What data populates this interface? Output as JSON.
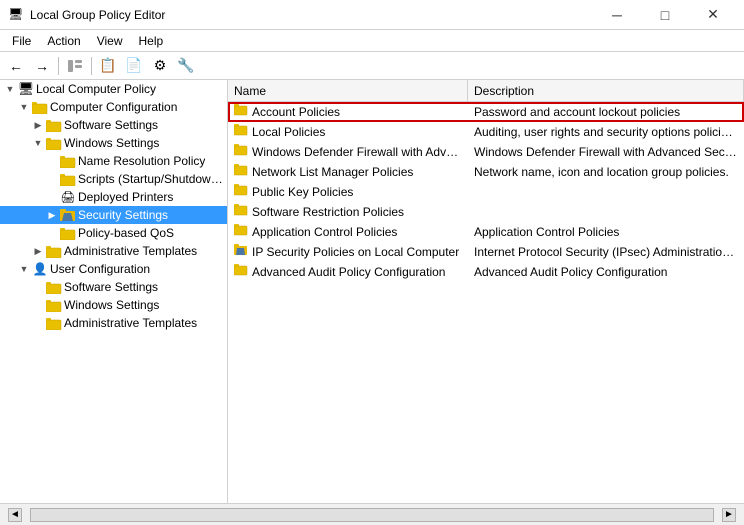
{
  "titleBar": {
    "icon": "🖥",
    "title": "Local Group Policy Editor",
    "minBtn": "─",
    "maxBtn": "□",
    "closeBtn": "✕"
  },
  "menuBar": {
    "items": [
      "File",
      "Action",
      "View",
      "Help"
    ]
  },
  "toolbar": {
    "buttons": [
      "←",
      "→",
      "⬆",
      "📋",
      "📄",
      "🗑",
      "⚙",
      "🔧"
    ]
  },
  "tree": {
    "items": [
      {
        "id": "local-computer-policy",
        "label": "Local Computer Policy",
        "indent": 0,
        "expander": "▼",
        "icon": "🖥",
        "iconClass": "folder-computer"
      },
      {
        "id": "computer-configuration",
        "label": "Computer Configuration",
        "indent": 1,
        "expander": "▼",
        "icon": "📁",
        "iconClass": "folder-yellow"
      },
      {
        "id": "software-settings-comp",
        "label": "Software Settings",
        "indent": 2,
        "expander": "▶",
        "icon": "📁",
        "iconClass": "folder-yellow"
      },
      {
        "id": "windows-settings",
        "label": "Windows Settings",
        "indent": 2,
        "expander": "▼",
        "icon": "📁",
        "iconClass": "folder-yellow"
      },
      {
        "id": "name-resolution-policy",
        "label": "Name Resolution Policy",
        "indent": 3,
        "expander": "",
        "icon": "📄",
        "iconClass": ""
      },
      {
        "id": "scripts-startup",
        "label": "Scripts (Startup/Shutdow…",
        "indent": 3,
        "expander": "",
        "icon": "📄",
        "iconClass": ""
      },
      {
        "id": "deployed-printers",
        "label": "Deployed Printers",
        "indent": 3,
        "expander": "",
        "icon": "🖨",
        "iconClass": ""
      },
      {
        "id": "security-settings",
        "label": "Security Settings",
        "indent": 3,
        "expander": "▶",
        "icon": "🛡",
        "iconClass": "",
        "selected": true
      },
      {
        "id": "policy-based-qos",
        "label": "Policy-based QoS",
        "indent": 3,
        "expander": "",
        "icon": "📄",
        "iconClass": ""
      },
      {
        "id": "admin-templates-comp",
        "label": "Administrative Templates",
        "indent": 2,
        "expander": "▶",
        "icon": "📁",
        "iconClass": "folder-yellow"
      },
      {
        "id": "user-configuration",
        "label": "User Configuration",
        "indent": 1,
        "expander": "▼",
        "icon": "👤",
        "iconClass": "folder-computer"
      },
      {
        "id": "software-settings-user",
        "label": "Software Settings",
        "indent": 2,
        "expander": "",
        "icon": "📁",
        "iconClass": "folder-yellow"
      },
      {
        "id": "windows-settings-user",
        "label": "Windows Settings",
        "indent": 2,
        "expander": "",
        "icon": "📁",
        "iconClass": "folder-yellow"
      },
      {
        "id": "admin-templates-user",
        "label": "Administrative Templates",
        "indent": 2,
        "expander": "",
        "icon": "📁",
        "iconClass": "folder-yellow"
      }
    ]
  },
  "listView": {
    "columns": [
      {
        "id": "name",
        "label": "Name"
      },
      {
        "id": "description",
        "label": "Description"
      }
    ],
    "rows": [
      {
        "id": "account-policies",
        "name": "Account Policies",
        "icon": "📁",
        "description": "Password and account lockout policies",
        "highlighted": true
      },
      {
        "id": "local-policies",
        "name": "Local Policies",
        "icon": "📁",
        "description": "Auditing, user rights and security options polici…"
      },
      {
        "id": "windows-defender",
        "name": "Windows Defender Firewall with Advanc…",
        "icon": "📁",
        "description": "Windows Defender Firewall with Advanced Sec…"
      },
      {
        "id": "network-list",
        "name": "Network List Manager Policies",
        "icon": "📁",
        "description": "Network name, icon and location group policies."
      },
      {
        "id": "public-key",
        "name": "Public Key Policies",
        "icon": "📁",
        "description": ""
      },
      {
        "id": "software-restriction",
        "name": "Software Restriction Policies",
        "icon": "📁",
        "description": ""
      },
      {
        "id": "app-control",
        "name": "Application Control Policies",
        "icon": "📁",
        "description": "Application Control Policies"
      },
      {
        "id": "ip-security",
        "name": "IP Security Policies on Local Computer",
        "icon": "🛡",
        "description": "Internet Protocol Security (IPsec) Administratio…"
      },
      {
        "id": "advanced-audit",
        "name": "Advanced Audit Policy Configuration",
        "icon": "📁",
        "description": "Advanced Audit Policy Configuration"
      }
    ]
  },
  "statusBar": {
    "leftArrow": "◄",
    "rightArrow": "►"
  }
}
